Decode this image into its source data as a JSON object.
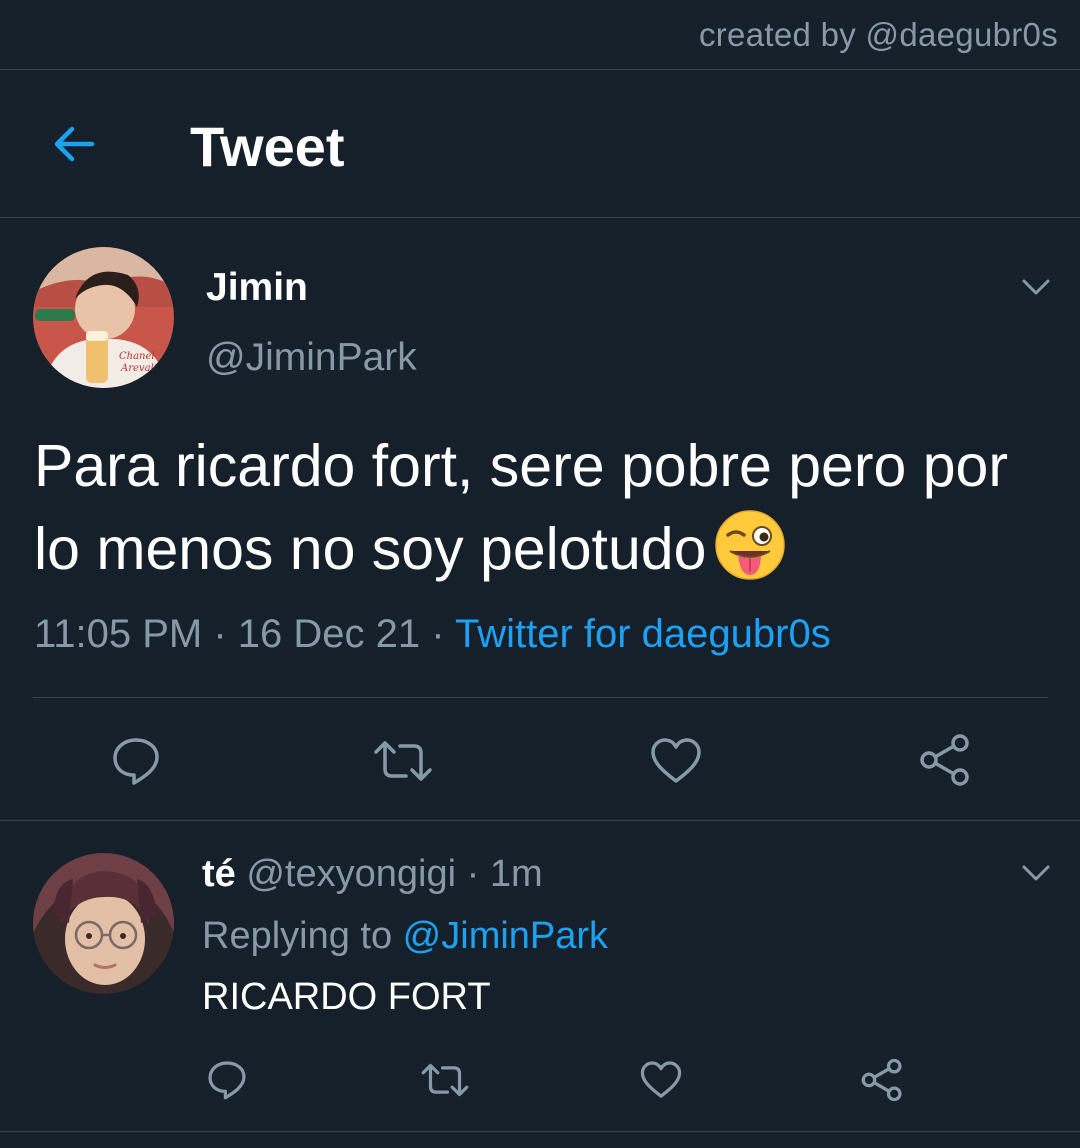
{
  "credit": "created by @daegubr0s",
  "header": {
    "title": "Tweet",
    "back_icon": "arrow-left-icon"
  },
  "colors": {
    "background": "#15202b",
    "accent": "#1da1f2",
    "secondary_text": "#8899a6",
    "divider": "#38444d"
  },
  "tweet": {
    "name": "Jimin",
    "handle": "@JiminPark",
    "text": "Para ricardo fort, sere pobre pero por lo menos no soy pelotudo",
    "emoji": "winking-face-with-tongue",
    "time": "11:05 PM",
    "date": "16 Dec 21",
    "source": "Twitter for daegubr0s",
    "separator": " · ",
    "actions": [
      "reply-icon",
      "retweet-icon",
      "like-icon",
      "share-icon"
    ]
  },
  "reply": {
    "name": "té",
    "handle": "@texyongigi",
    "age": "1m",
    "replying_prefix": "Replying to ",
    "replying_to": "@JiminPark",
    "text": "RICARDO FORT",
    "actions": [
      "reply-icon",
      "retweet-icon",
      "like-icon",
      "share-icon"
    ]
  }
}
